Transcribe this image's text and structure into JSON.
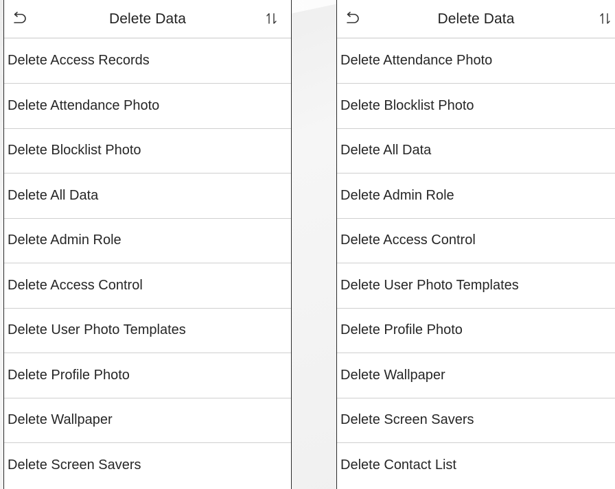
{
  "screens": [
    {
      "title": "Delete Data",
      "back_icon": "back-arrow-icon",
      "sort_icon": "sort-arrows-icon",
      "items": [
        "Delete Access Records",
        "Delete Attendance Photo",
        "Delete Blocklist Photo",
        "Delete All Data",
        "Delete Admin Role",
        "Delete Access Control",
        "Delete User Photo Templates",
        "Delete Profile Photo",
        "Delete Wallpaper",
        "Delete Screen Savers"
      ]
    },
    {
      "title": "Delete Data",
      "back_icon": "back-arrow-icon",
      "sort_icon": "sort-arrows-icon",
      "items": [
        "Delete Attendance Photo",
        "Delete Blocklist Photo",
        "Delete All Data",
        "Delete Admin Role",
        "Delete Access Control",
        "Delete User Photo Templates",
        "Delete Profile Photo",
        "Delete Wallpaper",
        "Delete Screen Savers",
        "Delete Contact List"
      ]
    }
  ],
  "colors": {
    "text": "#262626",
    "divider": "#cfcfcf",
    "panel_bg": "#ffffff",
    "backdrop": "#f3f3f3"
  }
}
